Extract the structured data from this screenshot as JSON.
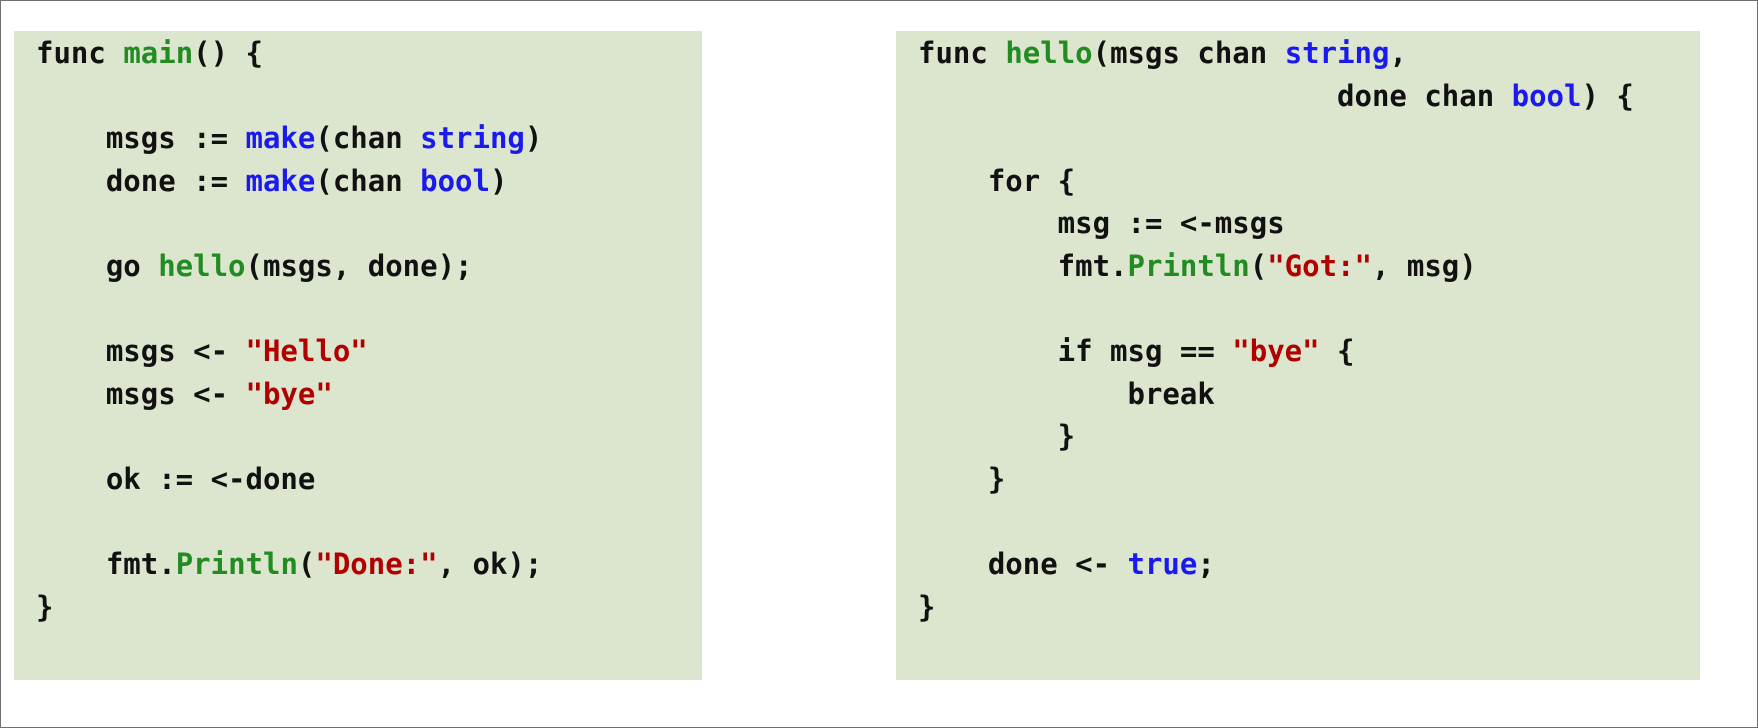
{
  "colors": {
    "background": "#ffffff",
    "panel": "#dce6cf",
    "plain": "#111111",
    "function_name": "#228b22",
    "builtin_type": "#1a1aee",
    "string_literal": "#b00000"
  },
  "code_panels": [
    {
      "lines": [
        [
          {
            "t": "func ",
            "k": "plain"
          },
          {
            "t": "main",
            "k": "func"
          },
          {
            "t": "() {",
            "k": "plain"
          }
        ],
        [],
        [
          {
            "t": "\tmsgs := ",
            "k": "plain"
          },
          {
            "t": "make",
            "k": "type"
          },
          {
            "t": "(chan ",
            "k": "plain"
          },
          {
            "t": "string",
            "k": "type"
          },
          {
            "t": ")",
            "k": "plain"
          }
        ],
        [
          {
            "t": "\tdone := ",
            "k": "plain"
          },
          {
            "t": "make",
            "k": "type"
          },
          {
            "t": "(chan ",
            "k": "plain"
          },
          {
            "t": "bool",
            "k": "type"
          },
          {
            "t": ")",
            "k": "plain"
          }
        ],
        [],
        [
          {
            "t": "\tgo ",
            "k": "plain"
          },
          {
            "t": "hello",
            "k": "func"
          },
          {
            "t": "(msgs, done);",
            "k": "plain"
          }
        ],
        [],
        [
          {
            "t": "\tmsgs <- ",
            "k": "plain"
          },
          {
            "t": "\"Hello\"",
            "k": "string"
          }
        ],
        [
          {
            "t": "\tmsgs <- ",
            "k": "plain"
          },
          {
            "t": "\"bye\"",
            "k": "string"
          }
        ],
        [],
        [
          {
            "t": "\tok := <-done",
            "k": "plain"
          }
        ],
        [],
        [
          {
            "t": "\tfmt.",
            "k": "plain"
          },
          {
            "t": "Println",
            "k": "func"
          },
          {
            "t": "(",
            "k": "plain"
          },
          {
            "t": "\"Done:\"",
            "k": "string"
          },
          {
            "t": ", ok);",
            "k": "plain"
          }
        ],
        [
          {
            "t": "}",
            "k": "plain"
          }
        ]
      ]
    },
    {
      "lines": [
        [
          {
            "t": "func ",
            "k": "plain"
          },
          {
            "t": "hello",
            "k": "func"
          },
          {
            "t": "(msgs chan ",
            "k": "plain"
          },
          {
            "t": "string",
            "k": "type"
          },
          {
            "t": ",",
            "k": "plain"
          }
        ],
        [
          {
            "t": "\t\t\t\t\t\tdone chan ",
            "k": "plain"
          },
          {
            "t": "bool",
            "k": "type"
          },
          {
            "t": ") {",
            "k": "plain"
          }
        ],
        [],
        [
          {
            "t": "\tfor {",
            "k": "plain"
          }
        ],
        [
          {
            "t": "\t\tmsg := <-msgs",
            "k": "plain"
          }
        ],
        [
          {
            "t": "\t\tfmt.",
            "k": "plain"
          },
          {
            "t": "Println",
            "k": "func"
          },
          {
            "t": "(",
            "k": "plain"
          },
          {
            "t": "\"Got:\"",
            "k": "string"
          },
          {
            "t": ", msg)",
            "k": "plain"
          }
        ],
        [],
        [
          {
            "t": "\t\tif msg == ",
            "k": "plain"
          },
          {
            "t": "\"bye\"",
            "k": "string"
          },
          {
            "t": " {",
            "k": "plain"
          }
        ],
        [
          {
            "t": "\t\t\tbreak",
            "k": "plain"
          }
        ],
        [
          {
            "t": "\t\t}",
            "k": "plain"
          }
        ],
        [
          {
            "t": "\t}",
            "k": "plain"
          }
        ],
        [],
        [
          {
            "t": "\tdone <- ",
            "k": "plain"
          },
          {
            "t": "true",
            "k": "type"
          },
          {
            "t": ";",
            "k": "plain"
          }
        ],
        [
          {
            "t": "}",
            "k": "plain"
          }
        ]
      ]
    }
  ]
}
